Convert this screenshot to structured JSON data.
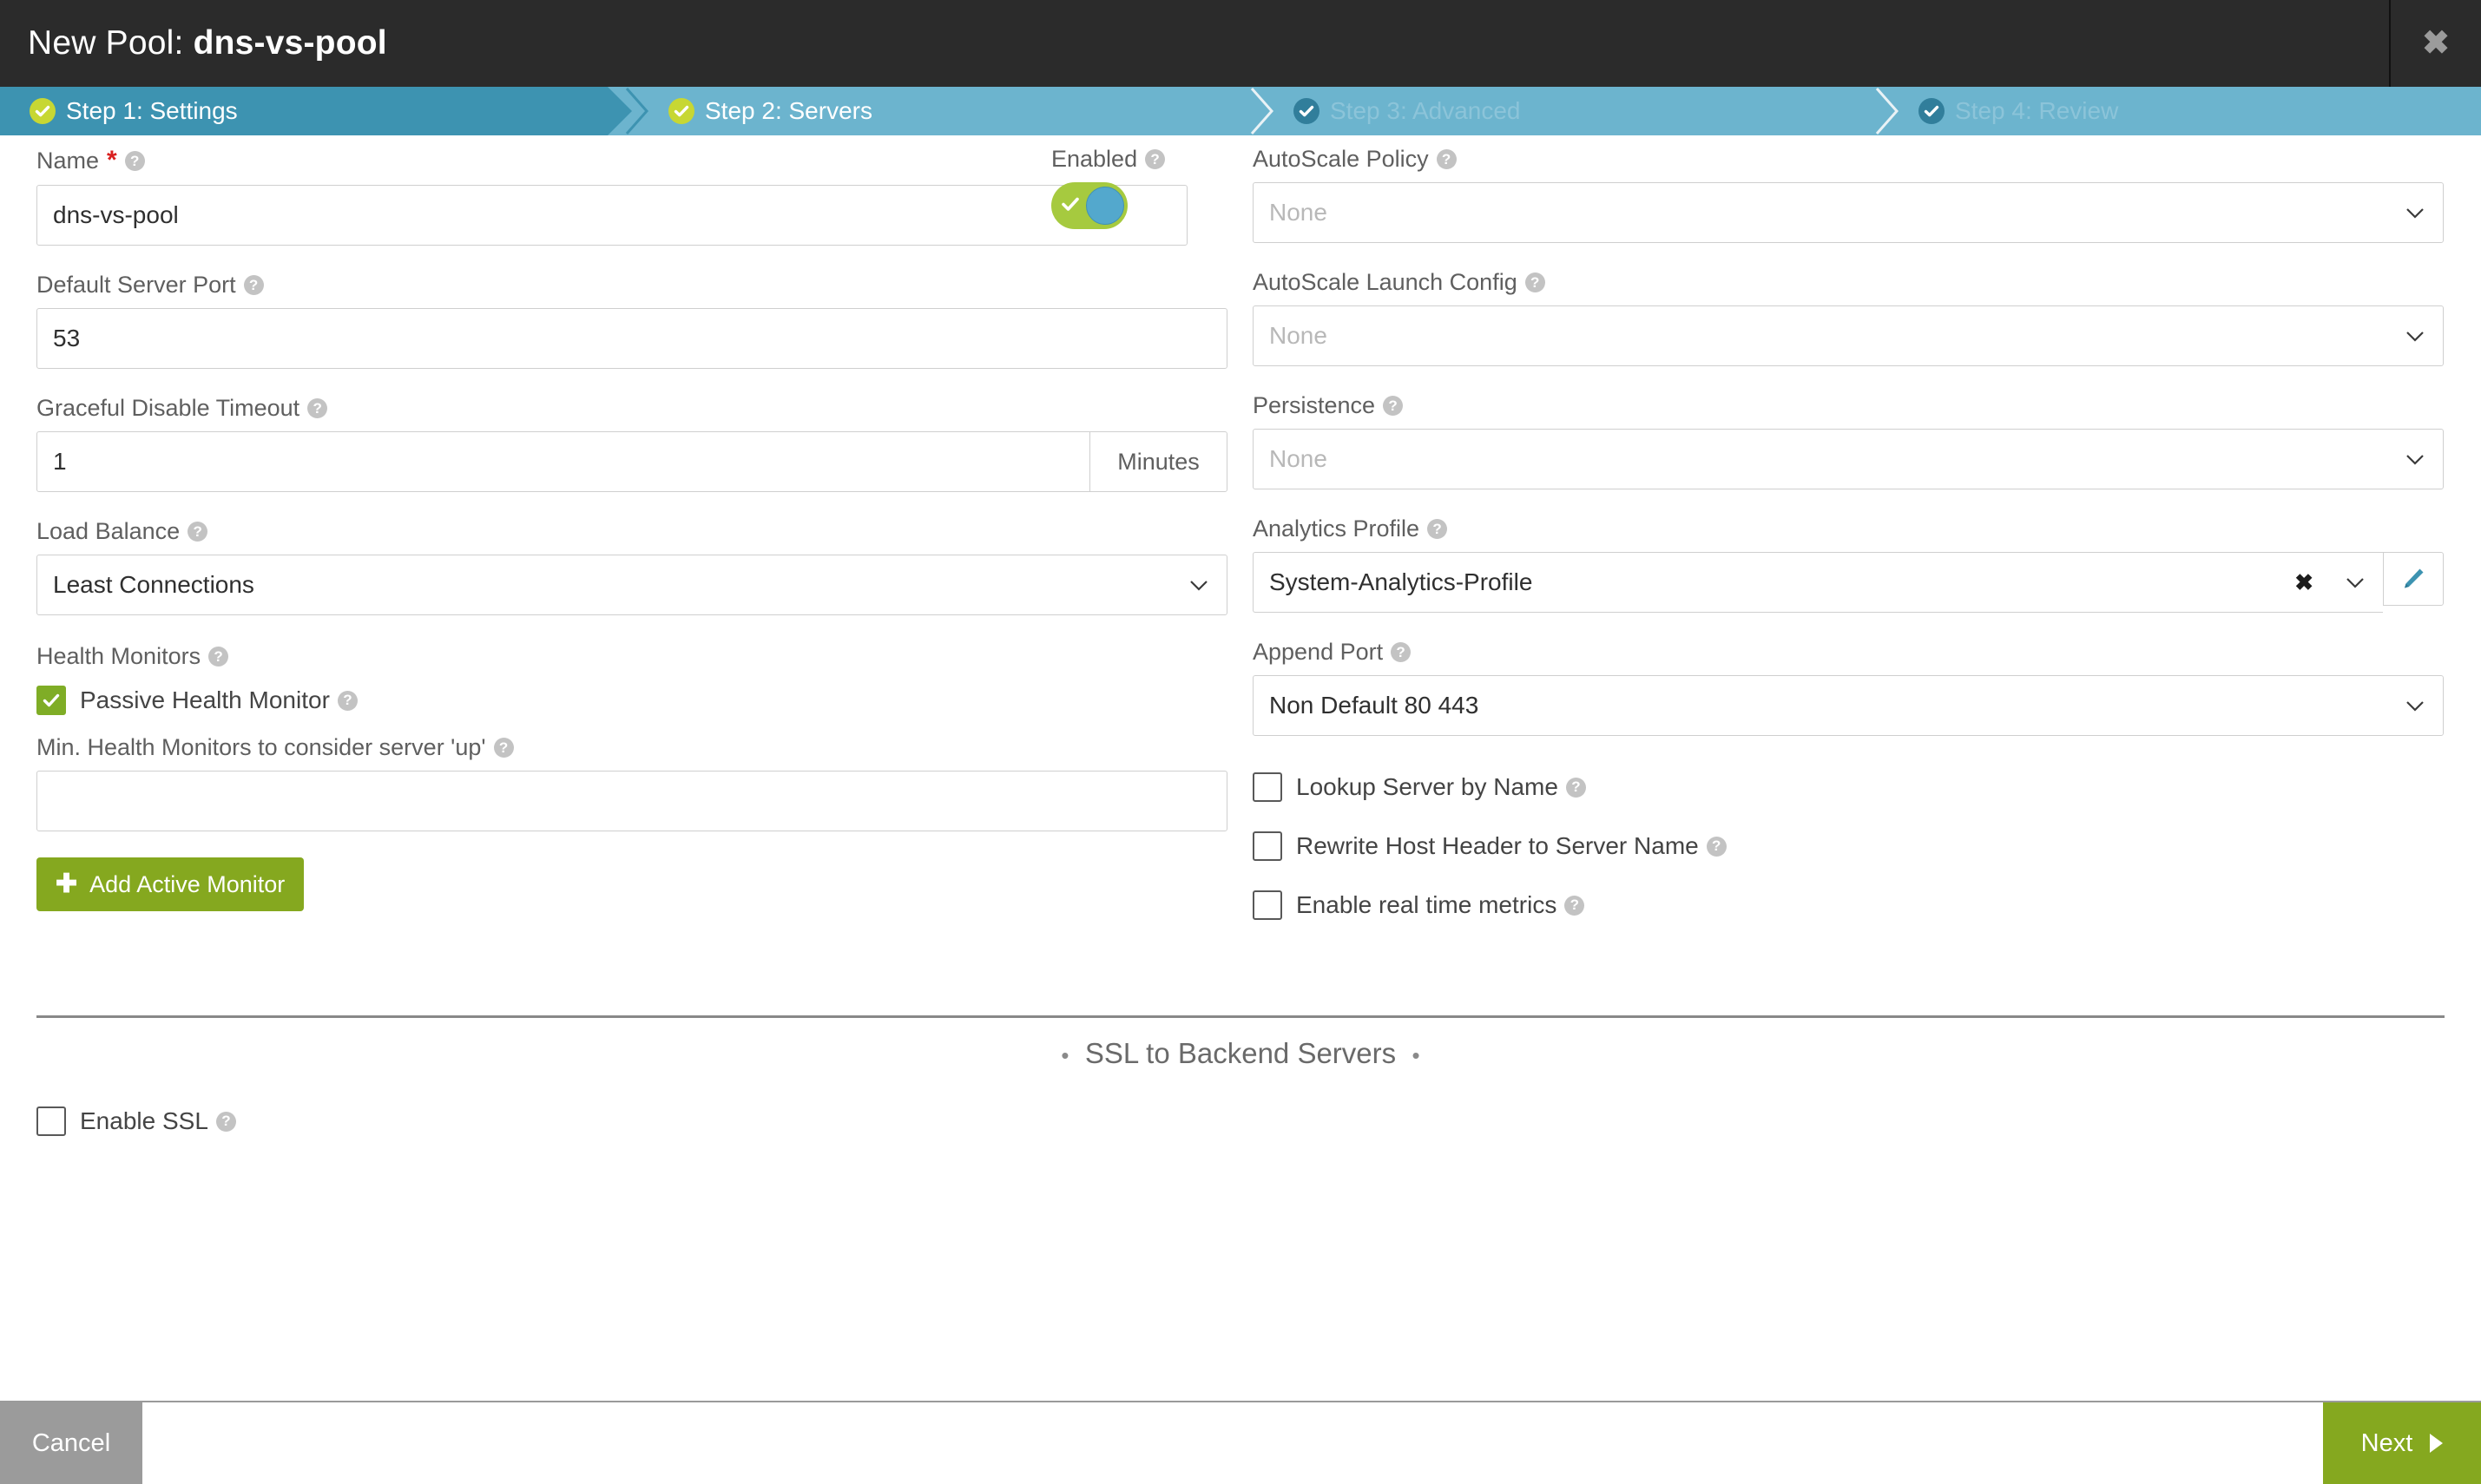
{
  "window": {
    "title_prefix": "New Pool: ",
    "title_name": "dns-vs-pool",
    "close_icon": "close-icon",
    "close_glyph": "✖"
  },
  "wizard": {
    "steps": [
      {
        "label": "Step 1: Settings",
        "state": "active",
        "check_icon": "check-circle-icon"
      },
      {
        "label": "Step 2: Servers",
        "state": "done",
        "check_icon": "check-circle-icon"
      },
      {
        "label": "Step 3: Advanced",
        "state": "pending",
        "check_icon": "check-circle-icon"
      },
      {
        "label": "Step 4: Review",
        "state": "pending",
        "check_icon": "check-circle-icon"
      }
    ],
    "active_bg": "#3d93b1",
    "inactive_bg": "#6cb4ce",
    "check_active_color": "#c7d733",
    "check_pending_color": "#317e9b"
  },
  "help_glyph": "?",
  "form": {
    "name": {
      "label": "Name",
      "required_marker": "*",
      "value": "dns-vs-pool",
      "help_icon": "help-icon"
    },
    "default_server_port": {
      "label": "Default Server Port",
      "value": "53"
    },
    "graceful_disable_timeout": {
      "label": "Graceful Disable Timeout",
      "value": "1",
      "unit": "Minutes"
    },
    "load_balance": {
      "label": "Load Balance",
      "value": "Least Connections",
      "chevron_icon": "chevron-down-icon"
    },
    "health_monitors": {
      "label": "Health Monitors",
      "passive": {
        "label": "Passive Health Monitor",
        "checked": true
      },
      "min_label": "Min. Health Monitors to consider server 'up'",
      "min_value": "",
      "add_button": "Add Active Monitor",
      "add_icon": "plus-icon"
    },
    "enabled": {
      "label": "Enabled",
      "value": true,
      "toggle_on_color": "#a6ca3f",
      "toggle_knob_color": "#53a8cd"
    },
    "autoscale_policy": {
      "label": "AutoScale Policy",
      "value": "",
      "placeholder": "None"
    },
    "autoscale_launch_config": {
      "label": "AutoScale Launch Config",
      "value": "",
      "placeholder": "None"
    },
    "persistence": {
      "label": "Persistence",
      "value": "",
      "placeholder": "None"
    },
    "analytics_profile": {
      "label": "Analytics Profile",
      "value": "System-Analytics-Profile",
      "clear_glyph": "✖",
      "clear_icon": "clear-icon",
      "edit_icon": "pencil-icon",
      "edit_color": "#3d93b1"
    },
    "append_port": {
      "label": "Append Port",
      "value": "Non Default 80 443"
    },
    "checkboxes": [
      {
        "label": "Lookup Server by Name",
        "checked": false
      },
      {
        "label": "Rewrite Host Header to Server Name",
        "checked": false
      },
      {
        "label": "Enable real time metrics",
        "checked": false
      }
    ]
  },
  "ssl_section": {
    "title": "SSL to Backend Servers",
    "bullet": "•",
    "enable_ssl": {
      "label": "Enable SSL",
      "checked": false
    }
  },
  "footer": {
    "cancel_label": "Cancel",
    "next_label": "Next",
    "next_icon": "arrow-right-icon"
  }
}
